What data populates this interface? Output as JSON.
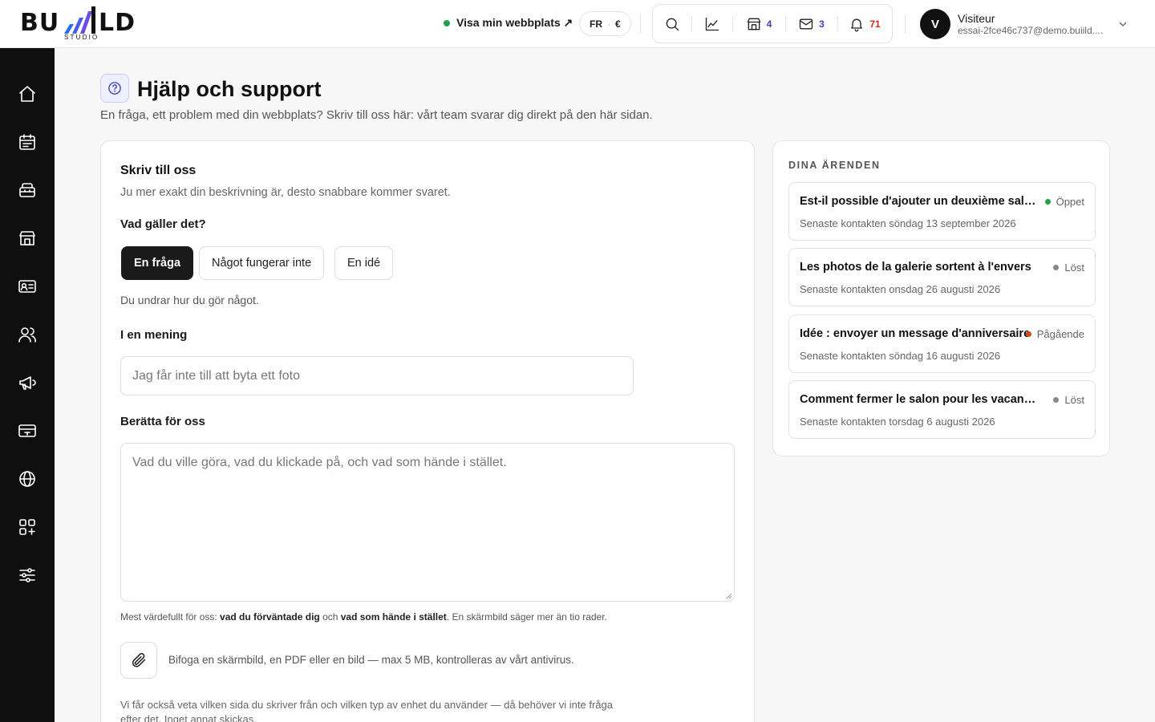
{
  "brand": {
    "logo": "BU LD",
    "logo_sub": "STUDIO"
  },
  "topbar": {
    "visit_label": "Visa min webbplats ↗",
    "lang": "FR",
    "currency": "€",
    "site_count": "4",
    "mail_count": "3",
    "notif_count": "71",
    "colors": {
      "online": "#1fa34a",
      "count_blue": "#3b3fc2",
      "count_red": "#d6261b"
    }
  },
  "user": {
    "initial": "V",
    "name": "Visiteur",
    "email": "essai-2fce46c737@demo.buiild...."
  },
  "sidebar": {
    "items": [
      {
        "icon": "home-icon"
      },
      {
        "icon": "calendar-icon"
      },
      {
        "icon": "cabinet-icon"
      },
      {
        "icon": "store-icon"
      },
      {
        "icon": "id-card-icon"
      },
      {
        "icon": "users-icon"
      },
      {
        "icon": "megaphone-icon"
      },
      {
        "icon": "payment-card-icon"
      },
      {
        "icon": "globe-icon"
      },
      {
        "icon": "apps-icon"
      },
      {
        "icon": "sliders-icon"
      }
    ]
  },
  "page": {
    "title": "Hjälp och support",
    "subtitle": "En fråga, ett problem med din webbplats? Skriv till oss här: vårt team svarar dig direkt på den här sidan."
  },
  "form": {
    "title": "Skriv till oss",
    "subtitle": "Ju mer exakt din beskrivning är, desto snabbare kommer svaret.",
    "topic_label": "Vad gäller det?",
    "topics": [
      "En fråga",
      "Något fungerar inte",
      "En idé"
    ],
    "selected_topic": "En fråga",
    "topic_hint": "Du undrar hur du gör något.",
    "summary_label": "I en mening",
    "summary_placeholder": "Jag får inte till att byta ett foto",
    "details_label": "Berätta för oss",
    "details_placeholder": "Vad du ville göra, vad du klickade på, och vad som hände i stället.",
    "note_prefix": "Mest värdefullt för oss: ",
    "note_bold1": "vad du förväntade dig",
    "note_mid": " och ",
    "note_bold2": "vad som hände i stället",
    "note_suffix": ". En skärmbild säger mer än tio rader.",
    "attach_text": "Bifoga en skärmbild, en PDF eller en bild — max 5 MB, kontrolleras av vårt antivirus.",
    "privacy_text": "Vi får också veta vilken sida du skriver från och vilken typ av enhet du använder — då behöver vi inte fråga efter det. Inget annat skickas."
  },
  "tickets": {
    "title": "DINA ÄRENDEN",
    "items": [
      {
        "title": "Est-il possible d'ajouter un deuxième salon ?",
        "status": "Öppet",
        "status_color": "#1fa34a",
        "date": "Senaste kontakten söndag 13 september 2026"
      },
      {
        "title": "Les photos de la galerie sortent à l'envers",
        "status": "Löst",
        "status_color": "#888888",
        "date": "Senaste kontakten onsdag 26 augusti 2026"
      },
      {
        "title": "Idée : envoyer un message d'anniversaire",
        "status": "Pågående",
        "status_color": "#d44a14",
        "date": "Senaste kontakten söndag 16 augusti 2026"
      },
      {
        "title": "Comment fermer le salon pour les vacances ?",
        "status": "Löst",
        "status_color": "#888888",
        "date": "Senaste kontakten torsdag 6 augusti 2026"
      }
    ]
  }
}
